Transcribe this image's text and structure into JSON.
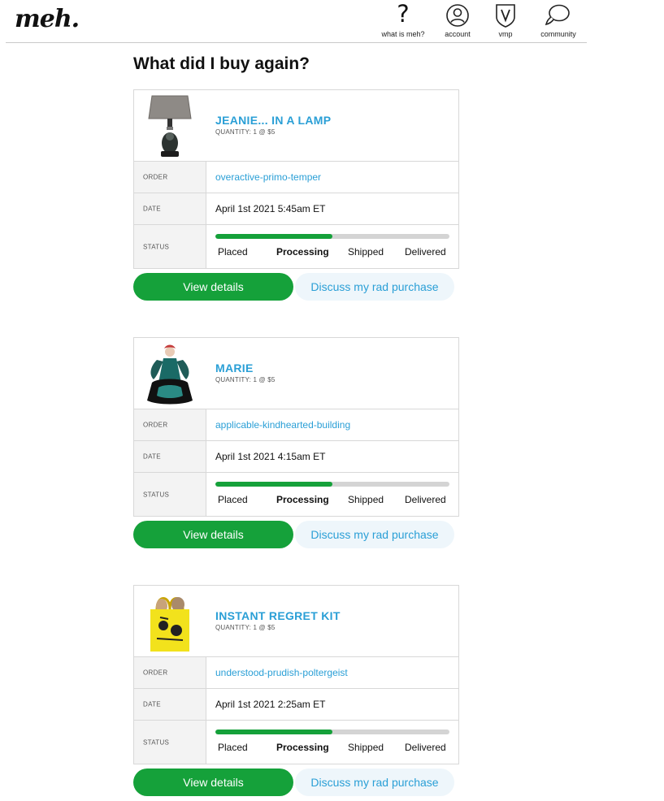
{
  "header": {
    "logo": "meh.",
    "nav": [
      {
        "label": "what is meh?",
        "icon": "question-icon",
        "glyph": "?"
      },
      {
        "label": "account",
        "icon": "account-icon"
      },
      {
        "label": "vmp",
        "icon": "vmp-shield-icon"
      },
      {
        "label": "community",
        "icon": "community-icon"
      }
    ]
  },
  "page": {
    "title": "What did I buy again?"
  },
  "labels": {
    "order": "ORDER",
    "date": "DATE",
    "status": "STATUS"
  },
  "status_steps": [
    "Placed",
    "Processing",
    "Shipped",
    "Delivered"
  ],
  "buttons": {
    "view_details": "View details",
    "discuss": "Discuss my rad purchase"
  },
  "colors": {
    "accent": "#2a9fd6",
    "progress": "#15a13a",
    "view_button": "#15a13a",
    "discuss_bg": "#eef6fb"
  },
  "orders": [
    {
      "title": "JEANIE... IN A LAMP",
      "quantity": "QUANTITY: 1 @ $5",
      "order_id": "overactive-primo-temper",
      "date": "April 1st 2021 5:45am ET",
      "status": "Processing",
      "progress": 0.5,
      "thumbnail_icon": "lamp-product-image"
    },
    {
      "title": "MARIE",
      "quantity": "QUANTITY: 1 @ $5",
      "order_id": "applicable-kindhearted-building",
      "date": "April 1st 2021 4:15am ET",
      "status": "Processing",
      "progress": 0.5,
      "thumbnail_icon": "doll-product-image"
    },
    {
      "title": "INSTANT REGRET KIT",
      "quantity": "QUANTITY: 1 @ $5",
      "order_id": "understood-prudish-poltergeist",
      "date": "April 1st 2021 2:25am ET",
      "status": "Processing",
      "progress": 0.5,
      "thumbnail_icon": "tote-bag-product-image"
    }
  ]
}
